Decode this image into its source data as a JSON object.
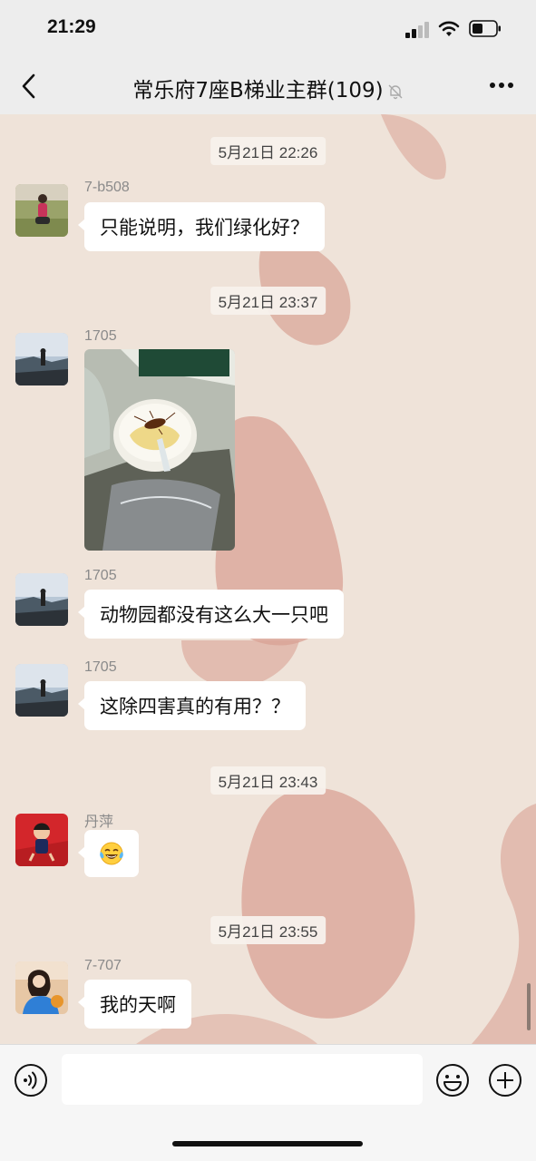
{
  "status_bar": {
    "time": "21:29"
  },
  "header": {
    "title": "常乐府7座B梯业主群(109)"
  },
  "messages": [
    {
      "kind": "timestamp",
      "text": "5月21日 22:26"
    },
    {
      "kind": "text",
      "sender": "7-b508",
      "text": "只能说明，我们绿化好？"
    },
    {
      "kind": "timestamp",
      "text": "5月21日 23:37"
    },
    {
      "kind": "image",
      "sender": "1705",
      "description": "cockroach-in-bowl-photo"
    },
    {
      "kind": "text",
      "sender": "1705",
      "text": "动物园都没有这么大一只吧"
    },
    {
      "kind": "text",
      "sender": "1705",
      "text": "这除四害真的有用？？"
    },
    {
      "kind": "timestamp",
      "text": "5月21日 23:43"
    },
    {
      "kind": "emoji",
      "sender": "丹萍",
      "emoji": "tears-of-joy"
    },
    {
      "kind": "timestamp",
      "text": "5月21日 23:55"
    },
    {
      "kind": "text",
      "sender": "7-707",
      "text": "我的天啊"
    }
  ],
  "input": {
    "value": "",
    "placeholder": ""
  },
  "colors": {
    "background": "#efe3d9",
    "bar": "#ededed",
    "bubble": "#ffffff",
    "heart": "#d9a294"
  }
}
